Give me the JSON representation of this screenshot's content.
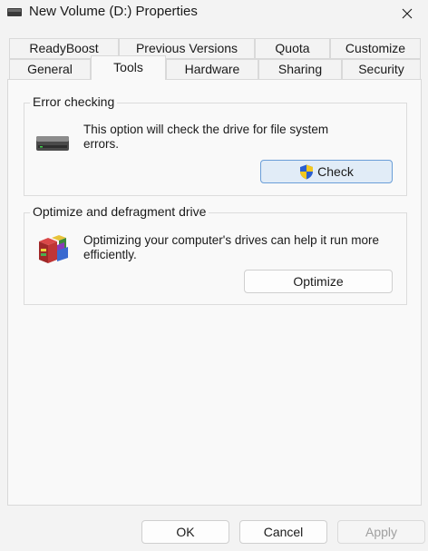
{
  "window": {
    "title": "New Volume (D:) Properties"
  },
  "tabs_row1": [
    {
      "label": "ReadyBoost"
    },
    {
      "label": "Previous Versions"
    },
    {
      "label": "Quota"
    },
    {
      "label": "Customize"
    }
  ],
  "tabs_row2": [
    {
      "label": "General"
    },
    {
      "label": "Tools",
      "active": true
    },
    {
      "label": "Hardware"
    },
    {
      "label": "Sharing"
    },
    {
      "label": "Security"
    }
  ],
  "error_checking": {
    "title": "Error checking",
    "description_line1": "This option will check the drive for file system",
    "description_line2": "errors.",
    "button_label": "Check"
  },
  "optimize": {
    "title": "Optimize and defragment drive",
    "description_line1": "Optimizing your computer's drives can help it run more",
    "description_line2": "efficiently.",
    "button_label": "Optimize"
  },
  "footer": {
    "ok_label": "OK",
    "cancel_label": "Cancel",
    "apply_label": "Apply"
  },
  "colors": {
    "accent_border": "#6a9ed8",
    "accent_fill": "#e1ecf7"
  }
}
